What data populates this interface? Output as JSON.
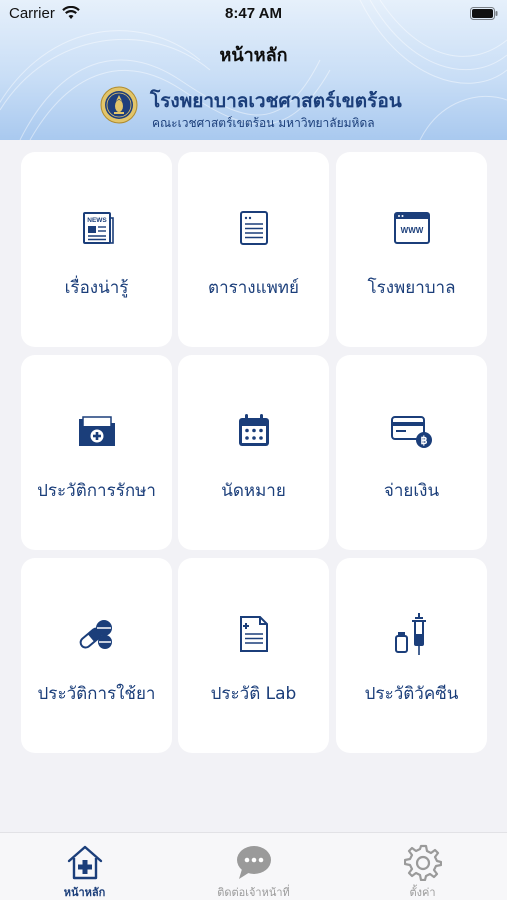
{
  "status_bar": {
    "carrier": "Carrier",
    "time": "8:47 AM"
  },
  "header": {
    "title": "หน้าหลัก",
    "hospital_name": "โรงพยาบาลเวชศาสตร์เขตร้อน",
    "faculty_name": "คณะเวชศาสตร์เขตร้อน มหาวิทยาลัยมหิดล"
  },
  "menu": {
    "items": [
      {
        "label": "เรื่องน่ารู้",
        "icon": "newspaper-icon"
      },
      {
        "label": "ตารางแพทย์",
        "icon": "document-list-icon"
      },
      {
        "label": "โรงพยาบาล",
        "icon": "web-browser-icon"
      },
      {
        "label": "ประวัติการรักษา",
        "icon": "medical-folder-icon"
      },
      {
        "label": "นัดหมาย",
        "icon": "calendar-icon"
      },
      {
        "label": "จ่ายเงิน",
        "icon": "payment-card-icon"
      },
      {
        "label": "ประวัติการใช้ยา",
        "icon": "pills-icon"
      },
      {
        "label": "ประวัติ Lab",
        "icon": "lab-report-icon"
      },
      {
        "label": "ประวัติวัคซีน",
        "icon": "vaccine-syringe-icon"
      }
    ]
  },
  "tabbar": {
    "tabs": [
      {
        "label": "หน้าหลัก",
        "icon": "home-medical-icon",
        "active": true
      },
      {
        "label": "ติดต่อเจ้าหน้าที่",
        "icon": "chat-bubble-icon",
        "active": false
      },
      {
        "label": "ตั้งค่า",
        "icon": "gear-icon",
        "active": false
      }
    ]
  },
  "colors": {
    "accent": "#1b3e7a",
    "header_gradient_top": "#e6f0fb",
    "header_gradient_bottom": "#a9c9ef",
    "background": "#f2f2f6",
    "card": "#ffffff",
    "tab_inactive": "#9a9a9a"
  }
}
